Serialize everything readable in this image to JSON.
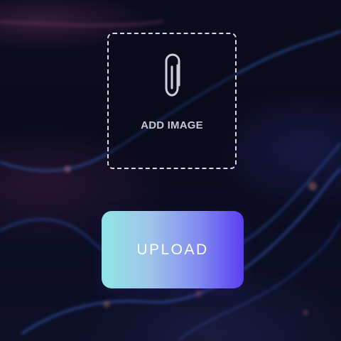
{
  "dropzone": {
    "label": "ADD IMAGE",
    "icon": "paperclip-icon"
  },
  "upload_button": {
    "label": "UPLOAD"
  },
  "colors": {
    "background": "#0a0b1e",
    "dropzone_border": "#d8d8e2",
    "dropzone_text": "#c9c9d4",
    "button_gradient_start": "#8fe6e2",
    "button_gradient_end": "#5b3ff3",
    "button_text": "#ffffff"
  }
}
